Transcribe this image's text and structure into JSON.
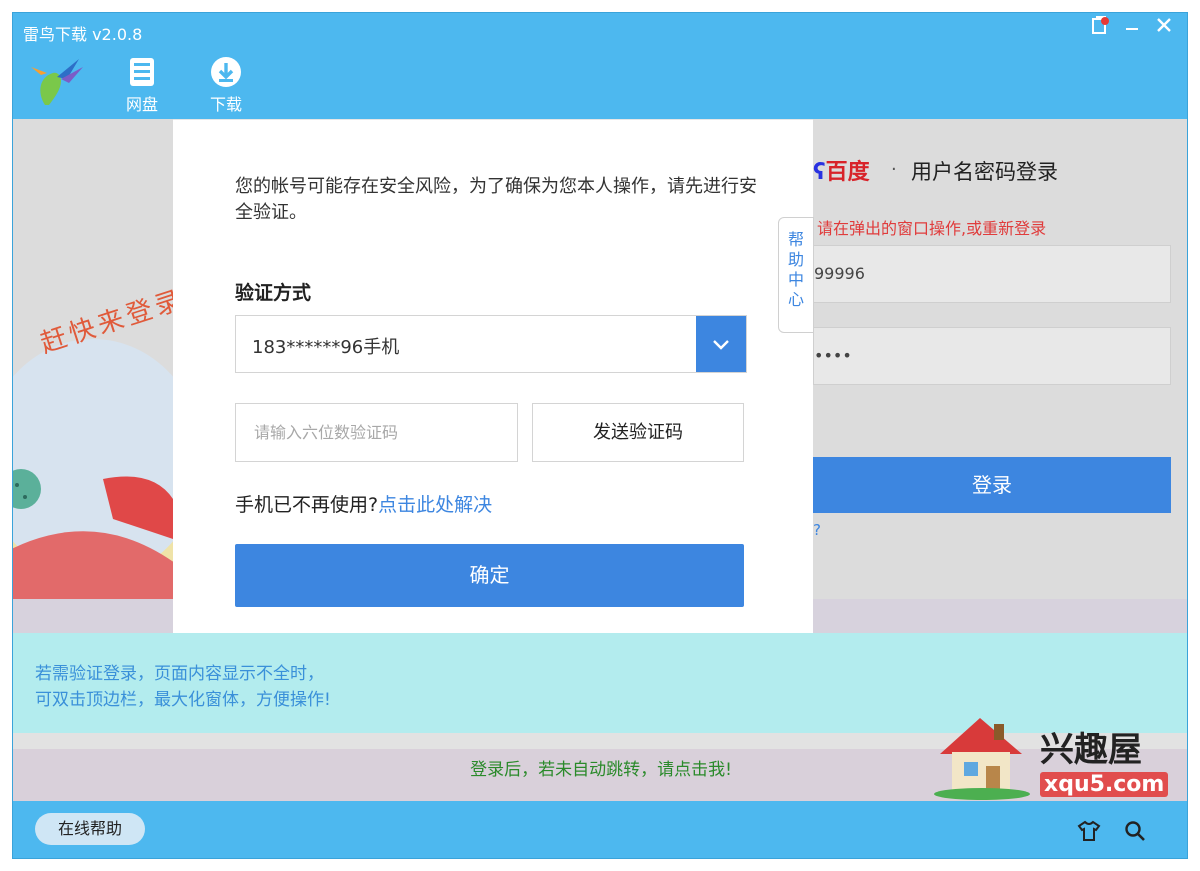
{
  "window": {
    "title": "雷鸟下载 v2.0.8"
  },
  "nav": [
    {
      "label": "网盘",
      "icon": "cloud-disk-icon"
    },
    {
      "label": "下载",
      "icon": "download-icon"
    }
  ],
  "left_banner": {
    "text": "赶快来登录"
  },
  "login": {
    "brand": "百度",
    "separator": "·",
    "title": "用户名密码登录",
    "warning": "请在弹出的窗口操作,或重新登录",
    "username_partial": "99996",
    "password_mask": "••••",
    "login_button": "登录",
    "forgot_partial": "?"
  },
  "help_tab": [
    "帮",
    "助",
    "中",
    "心"
  ],
  "dialog": {
    "message": "您的帐号可能存在安全风险，为了确保为您本人操作，请先进行安全验证。",
    "method_label": "验证方式",
    "method_value": "183******96手机",
    "code_placeholder": "请输入六位数验证码",
    "send_code": "发送验证码",
    "phone_question": "手机已不再使用?",
    "phone_link": "点击此处解决",
    "confirm": "确定"
  },
  "tips": {
    "line1": "若需验证登录，页面内容显示不全时，",
    "line2": "可双击顶边栏，最大化窗体，方便操作!"
  },
  "redirect_text": "登录后，若未自动跳转，请点击我!",
  "status": {
    "help_button": "在线帮助"
  },
  "watermark": {
    "name": "兴趣屋",
    "url": "xqu5.com"
  },
  "colors": {
    "accent": "#4db8ef",
    "primary": "#3d86e0",
    "danger": "#e03c3c",
    "tip": "#b3ecee"
  }
}
